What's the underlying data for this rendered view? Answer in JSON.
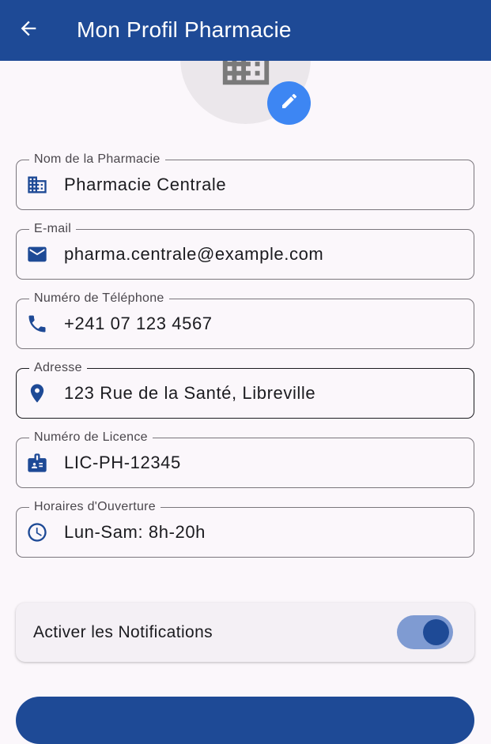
{
  "appbar": {
    "title": "Mon Profil Pharmacie",
    "back_icon": "arrow-back-icon"
  },
  "colors": {
    "primary": "#1e4a96",
    "fab": "#3d86f3",
    "background": "#fbf7fb"
  },
  "avatar": {
    "icon": "building-icon",
    "edit_icon": "pencil-icon"
  },
  "fields": [
    {
      "label": "Nom de la Pharmacie",
      "value": "Pharmacie Centrale",
      "icon": "building-icon"
    },
    {
      "label": "E-mail",
      "value": "pharma.centrale@example.com",
      "icon": "mail-icon"
    },
    {
      "label": "Numéro de Téléphone",
      "value": "+241 07 123 4567",
      "icon": "phone-icon"
    },
    {
      "label": "Adresse",
      "value": "123 Rue de la Santé, Libreville",
      "icon": "location-pin-icon"
    },
    {
      "label": "Numéro de Licence",
      "value": "LIC-PH-12345",
      "icon": "badge-icon"
    },
    {
      "label": "Horaires d'Ouverture",
      "value": "Lun-Sam: 8h-20h",
      "icon": "clock-icon"
    }
  ],
  "notifications": {
    "label": "Activer les Notifications",
    "enabled": true
  }
}
